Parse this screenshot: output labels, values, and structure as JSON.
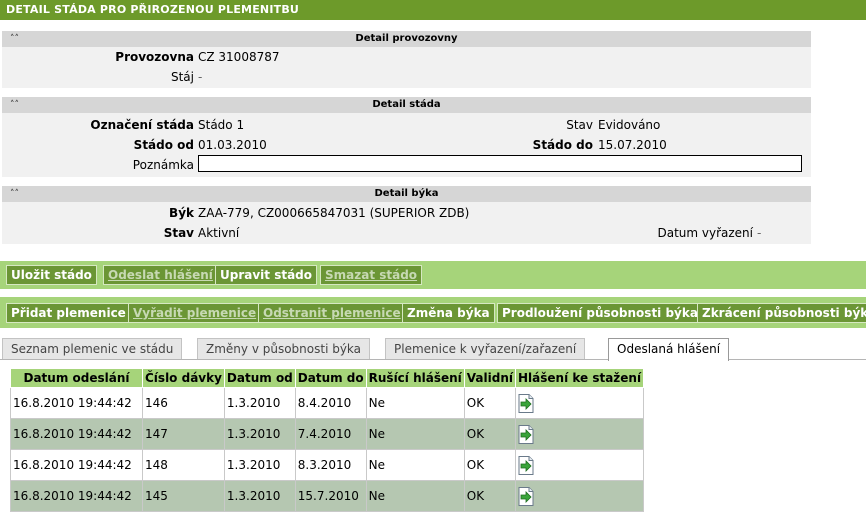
{
  "page_title": "Detail stáda pro přirozenou plemenitbu",
  "panel_provozovny": {
    "title": "Detail provozovny",
    "provozovna_label": "Provozovna",
    "provozovna_value": "CZ 31008787",
    "staj_label": "Stáj",
    "staj_value": "-"
  },
  "panel_stada": {
    "title": "Detail stáda",
    "oznaceni_label": "Označení stáda",
    "oznaceni_value": "Stádo 1",
    "stav_label": "Stav",
    "stav_value": "Evidováno",
    "od_label": "Stádo od",
    "od_value": "01.03.2010",
    "do_label": "Stádo do",
    "do_value": "15.07.2010",
    "poznamka_label": "Poznámka",
    "poznamka_value": ""
  },
  "panel_byka": {
    "title": "Detail býka",
    "byk_label": "Býk",
    "byk_value": "ZAA-779, CZ000665847031 (SUPERIOR ZDB)",
    "stav_label": "Stav",
    "stav_value": "Aktivní",
    "vyrazeni_label": "Datum vyřazení",
    "vyrazeni_value": "-"
  },
  "toolbar1": {
    "ulozit": "Uložit stádo",
    "odeslat": "Odeslat hlášení",
    "upravit": "Upravit stádo",
    "smazat": "Smazat stádo"
  },
  "toolbar2": {
    "pridat": "Přidat plemenice",
    "vyradit": "Vyřadit plemenice",
    "odstranit": "Odstranit plemenice",
    "zmena": "Změna býka",
    "prodlouzeni": "Prodloužení působnosti býka",
    "zkraceni": "Zkrácení působnosti býka"
  },
  "tabs": {
    "seznam": "Seznam plemenic ve stádu",
    "zmeny": "Změny v působnosti býka",
    "plemenice": "Plemenice k vyřazení/zařazení",
    "odeslana": "Odeslaná hlášení"
  },
  "table": {
    "headers": [
      "Datum odeslání",
      "Číslo dávky",
      "Datum od",
      "Datum do",
      "Rušící hlášení",
      "Validní",
      "Hlášení ke stažení"
    ],
    "rows": [
      [
        "16.8.2010 19:44:42",
        "146",
        "1.3.2010",
        "8.4.2010",
        "Ne",
        "OK"
      ],
      [
        "16.8.2010 19:44:42",
        "147",
        "1.3.2010",
        "7.4.2010",
        "Ne",
        "OK"
      ],
      [
        "16.8.2010 19:44:42",
        "148",
        "1.3.2010",
        "8.3.2010",
        "Ne",
        "OK"
      ],
      [
        "16.8.2010 19:44:42",
        "145",
        "1.3.2010",
        "15.7.2010",
        "Ne",
        "OK"
      ]
    ]
  },
  "icons": {
    "collapse": "double-chevron-up-icon",
    "download": "document-download-icon"
  },
  "colors": {
    "title_bar": "#6d9a2a",
    "toolbar_bg": "#a6d47a",
    "button_bg": "#6b9635",
    "row_alt": "#b5c7b1"
  }
}
